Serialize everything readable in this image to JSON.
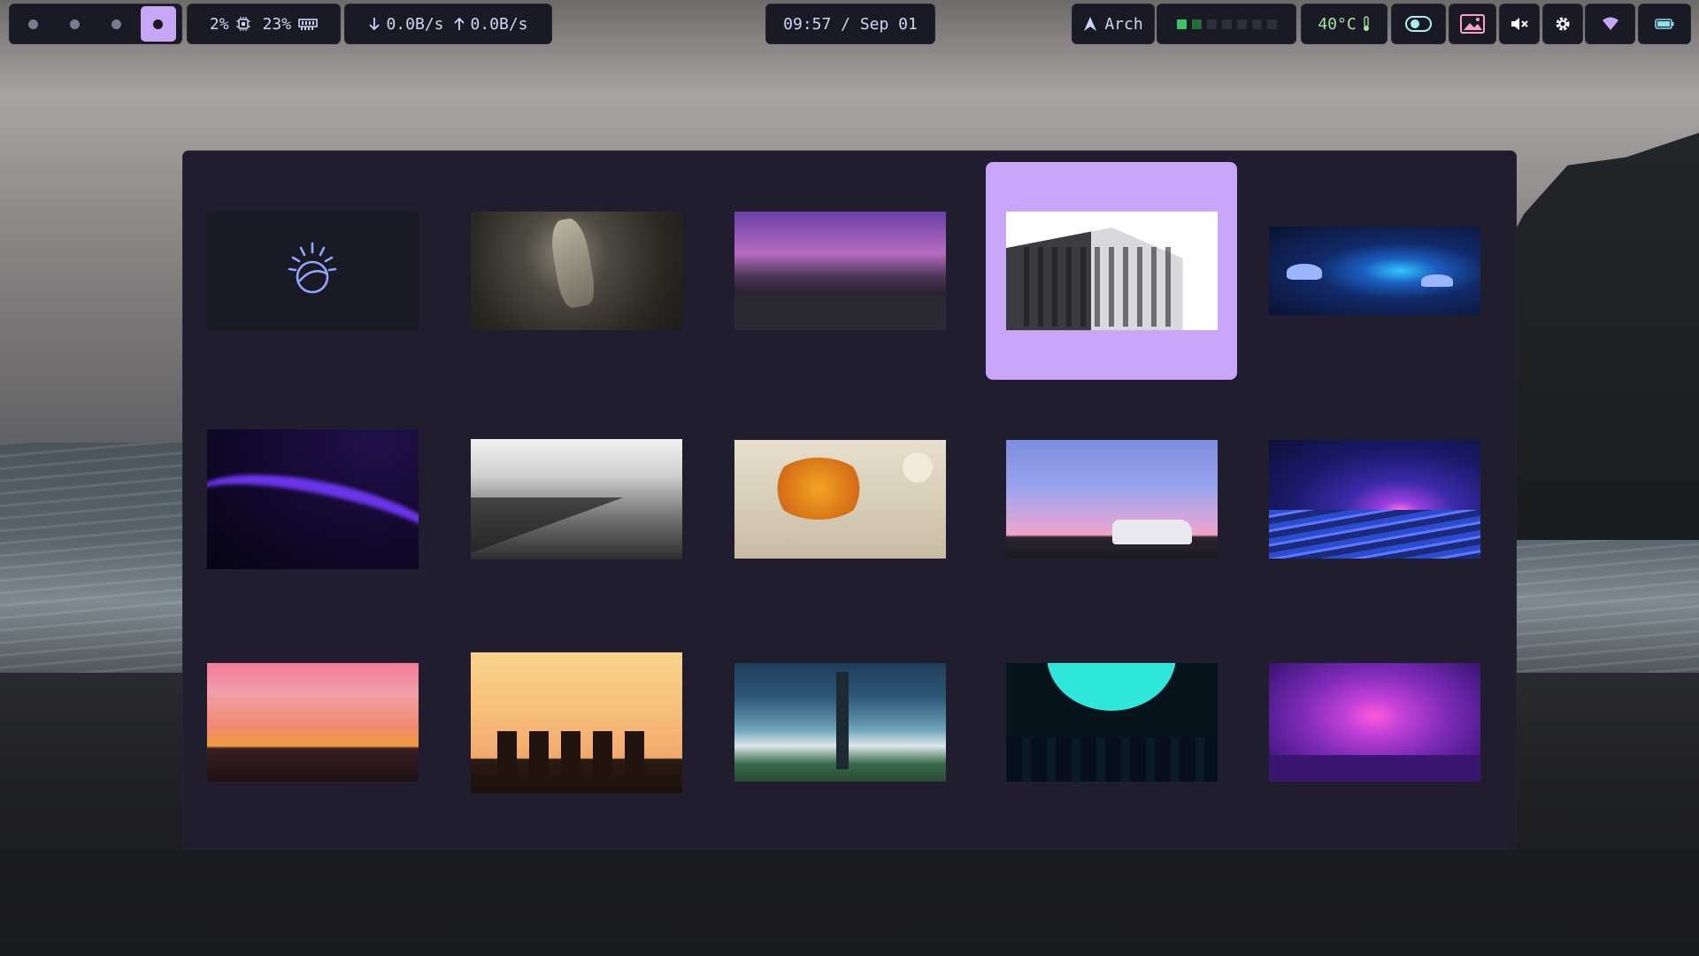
{
  "topbar": {
    "workspaces": [
      {
        "label": "",
        "active": false
      },
      {
        "label": "",
        "active": false
      },
      {
        "label": "",
        "active": false
      },
      {
        "label": "",
        "active": true
      }
    ],
    "cpu": "2%",
    "cpu_icon": "cpu-icon",
    "ram": "23%",
    "ram_icon": "memory-icon",
    "net_down": "0.0B/s",
    "net_up": "0.0B/s",
    "clock": "09:57 / Sep 01",
    "os_label": "Arch",
    "os_icon": "arch-logo-icon",
    "temperature": "40°C",
    "temperature_icon": "thermometer-icon",
    "icons": [
      "toggle-icon",
      "image-icon",
      "volume-mute-icon",
      "gear-icon",
      "wifi-icon",
      "battery-icon"
    ],
    "colors": {
      "accent": "#c9a5f7",
      "bar_bg": "#1a1a24",
      "status_green": "#40c463",
      "temp_text": "#a6e3a1"
    }
  },
  "wallpaper_picker": {
    "panel_bg": "#1f1d2e",
    "selected_index": 3,
    "rows": [
      [
        "logo-swirl",
        "statue",
        "purple-street",
        "hotel-building",
        "mushroom-cave"
      ],
      [
        "purple-wave",
        "foggy-forest",
        "autumn-tree",
        "car-sunset",
        "ocean-night"
      ],
      [
        "city-sunset",
        "city-golden",
        "cloud-tower",
        "cyan-moon",
        "purple-sky"
      ]
    ]
  }
}
